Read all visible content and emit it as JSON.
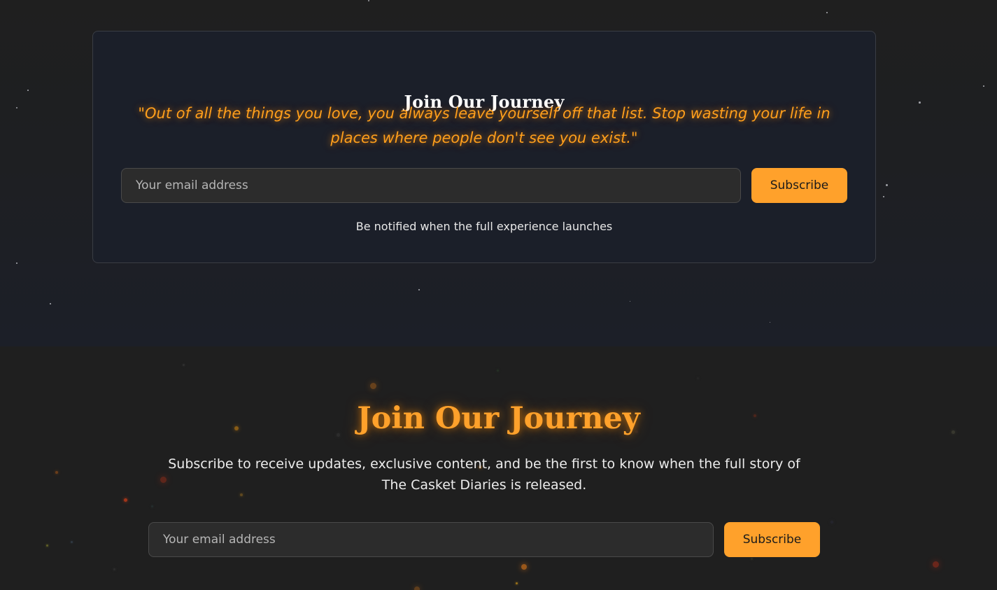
{
  "newsletter_card": {
    "title": "Join Our Journey",
    "quote": "\"Out of all the things you love, you always leave yourself off that list. Stop wasting your life in places where people don't see you exist.\"",
    "email_placeholder": "Your email address",
    "subscribe_label": "Subscribe",
    "note": "Be notified when the full experience launches"
  },
  "subscribe_section": {
    "title": "Join Our Journey",
    "description": "Subscribe to receive updates, exclusive content, and be the first to know when the full story of The Casket Diaries is released.",
    "email_placeholder": "Your email address",
    "subscribe_label": "Subscribe"
  },
  "colors": {
    "accent": "#ffa12b",
    "quote": "#ff9f1c",
    "card_background": "#1b1f29",
    "page_background": "#1e1e1e"
  }
}
